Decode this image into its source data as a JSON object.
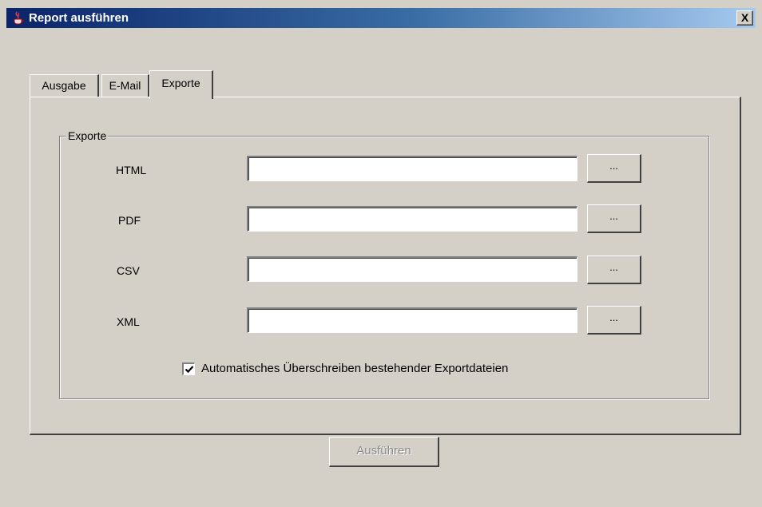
{
  "window": {
    "title": "Report ausführen",
    "close_label": "X",
    "app_icon": "java-coffee-cup-icon"
  },
  "tabs": [
    {
      "label": "Ausgabe",
      "active": false
    },
    {
      "label": "E-Mail",
      "active": false
    },
    {
      "label": "Exporte",
      "active": true
    }
  ],
  "exports_group": {
    "legend": "Exporte",
    "rows": [
      {
        "label": "HTML",
        "value": "",
        "browse_label": "..."
      },
      {
        "label": "PDF",
        "value": "",
        "browse_label": "..."
      },
      {
        "label": "CSV",
        "value": "",
        "browse_label": "..."
      },
      {
        "label": "XML",
        "value": "",
        "browse_label": "..."
      }
    ],
    "overwrite": {
      "label": "Automatisches Überschreiben bestehender Exportdateien",
      "checked": true
    }
  },
  "actions": {
    "run_label": "Ausführen",
    "run_enabled": false
  }
}
